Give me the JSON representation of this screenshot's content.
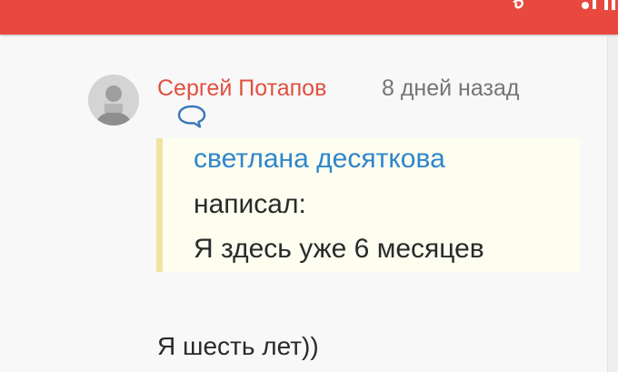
{
  "header": {
    "brand_color": "#e8493f",
    "icons": [
      "logo-fragment-icon"
    ]
  },
  "comment": {
    "author": "Сергей Потапов",
    "time": "8 дней назад",
    "author_color": "#e0503e",
    "reply_icon": "speech-bubble-icon",
    "quote": {
      "author": "светлана десяткова",
      "wrote_label": "написал:",
      "text": "Я здесь уже 6 месяцев",
      "author_color": "#2f86cb",
      "border_color": "#f1e4a1"
    },
    "body": "Я шесть лет))"
  }
}
